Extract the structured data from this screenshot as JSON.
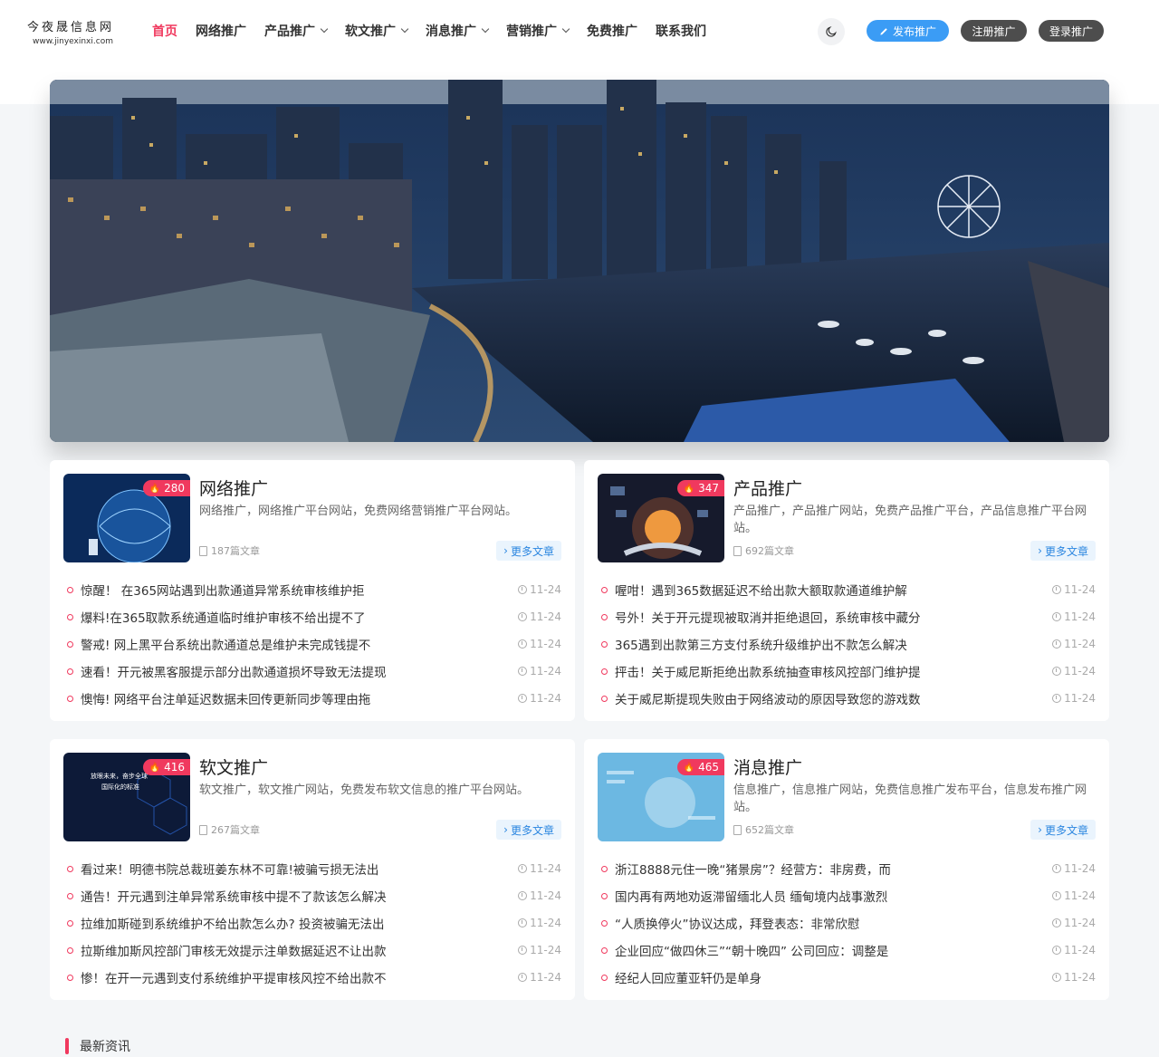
{
  "header": {
    "logo_title": "今夜晟信息网",
    "logo_sub": "www.jinyexinxi.com",
    "nav": [
      {
        "label": "首页",
        "active": true,
        "dropdown": false
      },
      {
        "label": "网络推广",
        "active": false,
        "dropdown": false
      },
      {
        "label": "产品推广",
        "active": false,
        "dropdown": true
      },
      {
        "label": "软文推广",
        "active": false,
        "dropdown": true
      },
      {
        "label": "消息推广",
        "active": false,
        "dropdown": true
      },
      {
        "label": "营销推广",
        "active": false,
        "dropdown": true
      },
      {
        "label": "免费推广",
        "active": false,
        "dropdown": false
      },
      {
        "label": "联系我们",
        "active": false,
        "dropdown": false
      }
    ],
    "btn_publish": "发布推广",
    "btn_register": "注册推广",
    "btn_login": "登录推广",
    "theme_icon": "moon-icon"
  },
  "colors": {
    "accent": "#f0395e",
    "blue": "#3b9cf5",
    "dark": "#4d4d4d"
  },
  "cards": [
    {
      "title": "网络推广",
      "badge": "280",
      "desc": "网络推广，网络推广平台网站，免费网络营销推广平台网站。",
      "count": "187篇文章",
      "more": "更多文章",
      "items": [
        {
          "text": "惊醒！ 在365网站遇到出款通道异常系统审核维护拒",
          "date": "11-24"
        },
        {
          "text": "爆料!在365取款系统通道临时维护审核不给出提不了",
          "date": "11-24"
        },
        {
          "text": "警戒! 网上黑平台系统出款通道总是维护未完成钱提不",
          "date": "11-24"
        },
        {
          "text": "速看！开元被黑客服提示部分出款通道损坏导致无法提现",
          "date": "11-24"
        },
        {
          "text": "懊悔! 网络平台注单延迟数据未回传更新同步等理由拖",
          "date": "11-24"
        }
      ]
    },
    {
      "title": "产品推广",
      "badge": "347",
      "desc": "产品推广，产品推广网站，免费产品推广平台，产品信息推广平台网站。",
      "count": "692篇文章",
      "more": "更多文章",
      "items": [
        {
          "text": "喔咁！遇到365数据延迟不给出款大额取款通道维护解",
          "date": "11-24"
        },
        {
          "text": "号外！关于开元提现被取消并拒绝退回，系统审核中藏分",
          "date": "11-24"
        },
        {
          "text": "365遇到出款第三方支付系统升级维护出不款怎么解决",
          "date": "11-24"
        },
        {
          "text": "抨击！关于威尼斯拒绝出款系统抽查审核风控部门维护提",
          "date": "11-24"
        },
        {
          "text": "关于威尼斯提现失败由于网络波动的原因导致您的游戏数",
          "date": "11-24"
        }
      ]
    },
    {
      "title": "软文推广",
      "badge": "416",
      "desc": "软文推广，软文推广网站，免费发布软文信息的推广平台网站。",
      "count": "267篇文章",
      "more": "更多文章",
      "thumb_text": [
        "放眼未来，奋步全球",
        "国际化的标准"
      ],
      "items": [
        {
          "text": "看过来！明德书院总裁班姜东林不可靠!被骗亏损无法出",
          "date": "11-24"
        },
        {
          "text": "通告！开元遇到注单异常系统审核中提不了款该怎么解决",
          "date": "11-24"
        },
        {
          "text": "拉维加斯碰到系统维护不给出款怎么办? 投资被骗无法出",
          "date": "11-24"
        },
        {
          "text": "拉斯维加斯风控部门审核无效提示注单数据延迟不让出款",
          "date": "11-24"
        },
        {
          "text": "惨！在开一元遇到支付系统维护平提审核风控不给出款不",
          "date": "11-24"
        }
      ]
    },
    {
      "title": "消息推广",
      "badge": "465",
      "desc": "信息推广，信息推广网站，免费信息推广发布平台，信息发布推广网站。",
      "count": "652篇文章",
      "more": "更多文章",
      "items": [
        {
          "text": "浙江8888元住一晚“猪景房”？经营方：非房费，而",
          "date": "11-24"
        },
        {
          "text": "国内再有两地劝返滞留缅北人员 缅甸境内战事激烈",
          "date": "11-24"
        },
        {
          "text": "“人质换停火”协议达成，拜登表态：非常欣慰",
          "date": "11-24"
        },
        {
          "text": "企业回应“做四休三”“朝十晚四” 公司回应：调整是",
          "date": "11-24"
        },
        {
          "text": "经纪人回应董亚轩仍是单身",
          "date": "11-24"
        }
      ]
    }
  ],
  "section": {
    "title": "最新资讯"
  }
}
